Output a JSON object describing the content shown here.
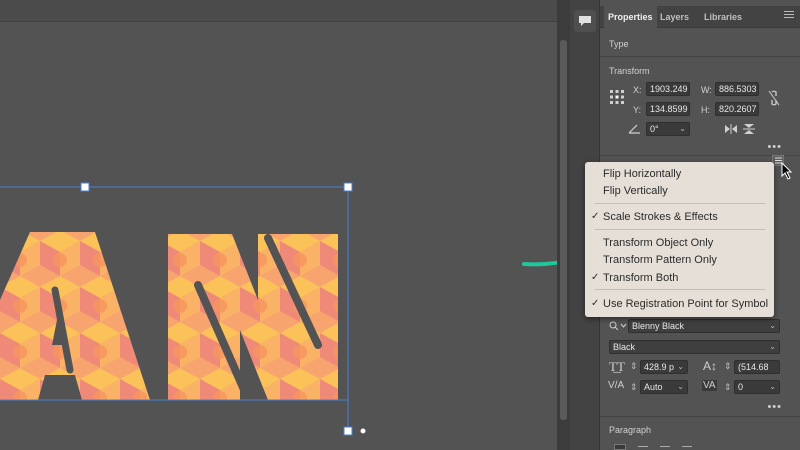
{
  "panel": {
    "tabs": [
      {
        "label": "Properties"
      },
      {
        "label": "Layers"
      },
      {
        "label": "Libraries"
      }
    ],
    "type_section": "Type",
    "transform": {
      "title": "Transform",
      "x_label": "X:",
      "x_value": "1903.249",
      "y_label": "Y:",
      "y_value": "134.8599",
      "w_label": "W:",
      "w_value": "886.5303",
      "h_label": "H:",
      "h_value": "820.2607",
      "angle_value": "0°"
    },
    "more_dots": "•••",
    "character": {
      "font_family": "Blenny Black",
      "font_style": "Black",
      "size_value": "428.9 p",
      "leading_value": "(514.68",
      "kerning_value": "Auto",
      "tracking_value": "0"
    },
    "paragraph_title": "Paragraph"
  },
  "menu": {
    "items": [
      {
        "label": "Flip Horizontally",
        "checked": false
      },
      {
        "label": "Flip Vertically",
        "checked": false
      },
      {
        "label": "Scale Strokes & Effects",
        "checked": true
      },
      {
        "label": "Transform Object Only",
        "checked": false
      },
      {
        "label": "Transform Pattern Only",
        "checked": false
      },
      {
        "label": "Transform Both",
        "checked": true
      },
      {
        "label": "Use Registration Point for Symbol",
        "checked": true
      }
    ],
    "check_glyph": "✓"
  },
  "colors": {
    "canvas_bg": "#535353",
    "pattern_coral": "#f08a78",
    "pattern_yellow": "#fbc25a",
    "pattern_peach": "#f7a46f",
    "selection": "#4a7fd6",
    "annotation_arrow": "#1fc79a",
    "menu_bg": "#e5dfd8"
  },
  "icons": {
    "comment": "comment-icon",
    "panel_menu": "hamburger-icon",
    "reference_point": "reference-point-icon",
    "link": "constrain-proportions-icon",
    "flip_h": "flip-horizontal-icon",
    "flip_v": "flip-vertical-icon",
    "angle": "rotate-angle-icon",
    "font_size": "font-size-icon",
    "leading": "leading-icon",
    "kerning": "kerning-icon",
    "tracking": "tracking-icon",
    "cursor": "mouse-pointer-icon",
    "arrow": "green-annotation-arrow-icon"
  }
}
